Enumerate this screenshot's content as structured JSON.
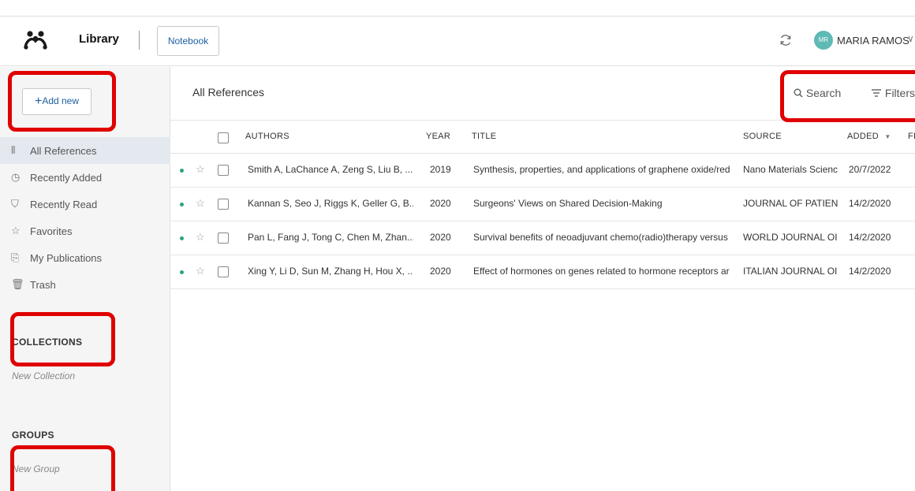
{
  "header": {
    "app_title": "Library",
    "notebook_label": "Notebook",
    "avatar_initials": "MR",
    "user_name": "MARIA RAMOS",
    "chevron": "∨"
  },
  "sidebar": {
    "add_new_label": "Add new",
    "add_icon": "+",
    "items": [
      {
        "icon": "library-icon",
        "glyph": "⫴",
        "label": "All References",
        "active": true
      },
      {
        "icon": "clock-icon",
        "glyph": "◷",
        "label": "Recently Added"
      },
      {
        "icon": "bookmark-icon",
        "glyph": "⛉",
        "label": "Recently Read"
      },
      {
        "icon": "star-icon",
        "glyph": "☆",
        "label": "Favorites"
      },
      {
        "icon": "publication-icon",
        "glyph": "⎘",
        "label": "My Publications"
      },
      {
        "icon": "trash-icon",
        "glyph": "🗑",
        "label": "Trash"
      }
    ],
    "collections_title": "COLLECTIONS",
    "new_collection": "New Collection",
    "groups_title": "GROUPS",
    "new_group": "New Group"
  },
  "main": {
    "title": "All References",
    "search_label": "Search",
    "filters_label": "Filters",
    "columns": {
      "authors": "AUTHORS",
      "year": "YEAR",
      "title": "TITLE",
      "source": "SOURCE",
      "added": "ADDED",
      "sort_icon": "▼",
      "file": "FI"
    },
    "rows": [
      {
        "authors": "Smith A, LaChance A, Zeng S, Liu B, ...",
        "year": "2019",
        "title": "Synthesis, properties, and applications of graphene oxide/red",
        "source": "Nano Materials Scienc",
        "added": "20/7/2022"
      },
      {
        "authors": "Kannan S, Seo J, Riggs K, Geller G, B...",
        "year": "2020",
        "title": "Surgeons' Views on Shared Decision-Making",
        "source": "JOURNAL OF PATIEN",
        "added": "14/2/2020"
      },
      {
        "authors": "Pan L, Fang J, Tong C, Chen M, Zhan...",
        "year": "2020",
        "title": "Survival benefits of neoadjuvant chemo(radio)therapy versus",
        "source": "WORLD JOURNAL OI",
        "added": "14/2/2020"
      },
      {
        "authors": "Xing Y, Li D, Sun M, Zhang H, Hou X, ...",
        "year": "2020",
        "title": "Effect of hormones on genes related to hormone receptors ar",
        "source": "ITALIAN JOURNAL OI",
        "added": "14/2/2020"
      }
    ]
  },
  "colors": {
    "highlight": "#e00000",
    "accent": "#1f5fa0",
    "avatar": "#5fb9b4",
    "unread_dot": "#2aa672"
  }
}
